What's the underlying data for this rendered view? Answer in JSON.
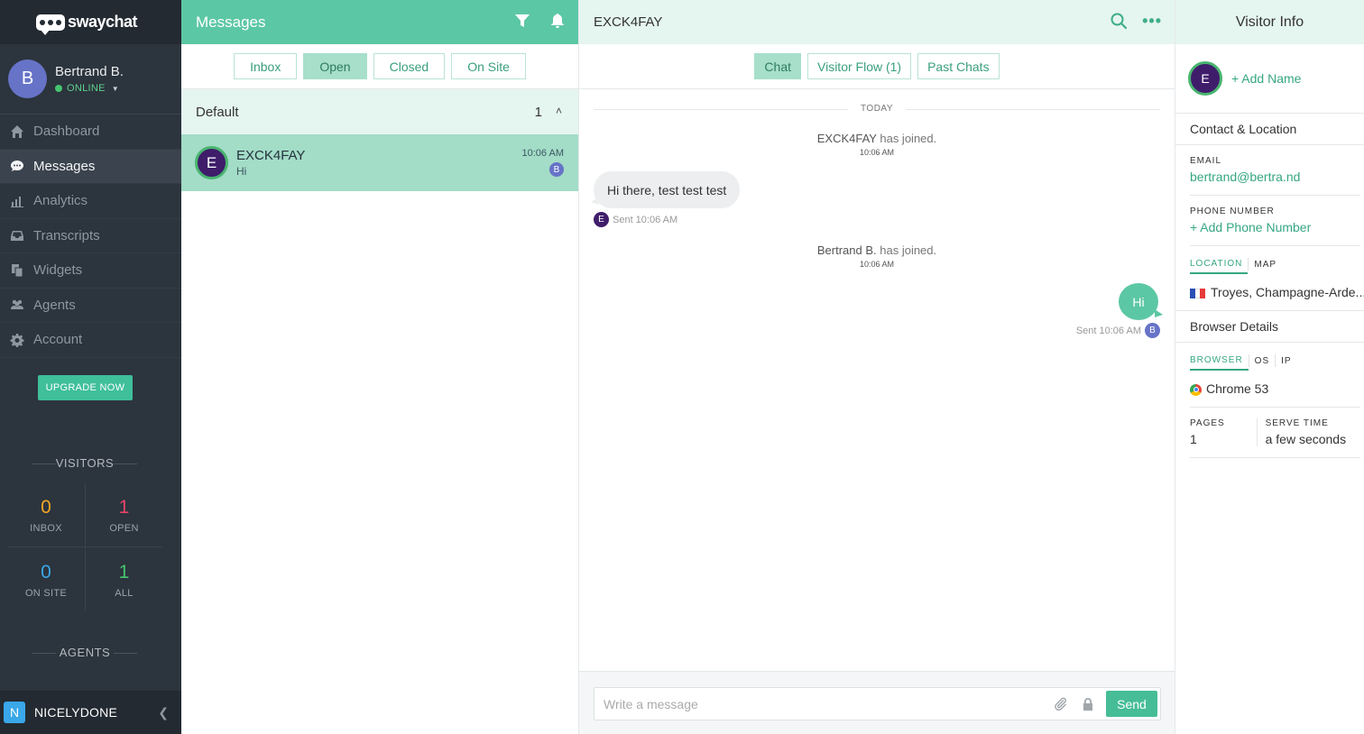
{
  "sidebar": {
    "logo_text": "swaychat",
    "profile": {
      "initial": "B",
      "name": "Bertrand B.",
      "status": "ONLINE"
    },
    "nav": [
      {
        "label": "Dashboard",
        "icon": "home-icon"
      },
      {
        "label": "Messages",
        "icon": "chat-icon",
        "active": true
      },
      {
        "label": "Analytics",
        "icon": "bar-chart-icon"
      },
      {
        "label": "Transcripts",
        "icon": "inbox-icon"
      },
      {
        "label": "Widgets",
        "icon": "copy-icon"
      },
      {
        "label": "Agents",
        "icon": "users-icon"
      },
      {
        "label": "Account",
        "icon": "gear-icon"
      }
    ],
    "upgrade_label": "UPGRADE NOW",
    "visitors_title": "VISITORS",
    "visitor_stats": [
      {
        "value": "0",
        "label": "INBOX",
        "color": "#f5a623"
      },
      {
        "value": "1",
        "label": "OPEN",
        "color": "#e8436b"
      },
      {
        "value": "0",
        "label": "ON SITE",
        "color": "#3aa7e8"
      },
      {
        "value": "1",
        "label": "ALL",
        "color": "#46c46f"
      }
    ],
    "agents_title": "AGENTS",
    "workspace": {
      "initial": "N",
      "name": "NICELYDONE"
    }
  },
  "messages": {
    "title": "Messages",
    "filters": [
      "Inbox",
      "Open",
      "Closed",
      "On Site"
    ],
    "active_filter": "Open",
    "group": {
      "name": "Default",
      "count": "1"
    },
    "conversations": [
      {
        "initial": "E",
        "name": "EXCK4FAY",
        "preview": "Hi",
        "time": "10:06 AM",
        "agent_initial": "B"
      }
    ]
  },
  "chat": {
    "title": "EXCK4FAY",
    "tabs": [
      "Chat",
      "Visitor Flow (1)",
      "Past Chats"
    ],
    "active_tab": "Chat",
    "day_divider": "TODAY",
    "events": [
      {
        "who": "EXCK4FAY",
        "text": "has joined.",
        "time": "10:06 AM"
      },
      {
        "who": "Bertrand B.",
        "text": "has joined.",
        "time": "10:06 AM"
      }
    ],
    "incoming": {
      "text": "Hi there, test test test",
      "meta": "Sent 10:06 AM",
      "avatar": "E"
    },
    "outgoing": {
      "text": "Hi",
      "meta": "Sent 10:06 AM",
      "avatar": "B"
    },
    "composer_placeholder": "Write a message",
    "send_label": "Send"
  },
  "visitor_info": {
    "title": "Visitor Info",
    "avatar": "E",
    "add_name": "+ Add Name",
    "contact_section": "Contact & Location",
    "email_label": "EMAIL",
    "email": "bertrand@bertra.nd",
    "phone_label": "PHONE NUMBER",
    "add_phone": "+ Add Phone Number",
    "location_tab": "LOCATION",
    "map_tab": "MAP",
    "location": "Troyes, Champagne-Arde...",
    "browser_section": "Browser Details",
    "browser_tab": "BROWSER",
    "os_tab": "OS",
    "ip_tab": "IP",
    "browser": "Chrome 53",
    "pages_label": "PAGES",
    "pages": "1",
    "serve_time_label": "SERVE TIME",
    "serve_time": "a few seconds"
  }
}
